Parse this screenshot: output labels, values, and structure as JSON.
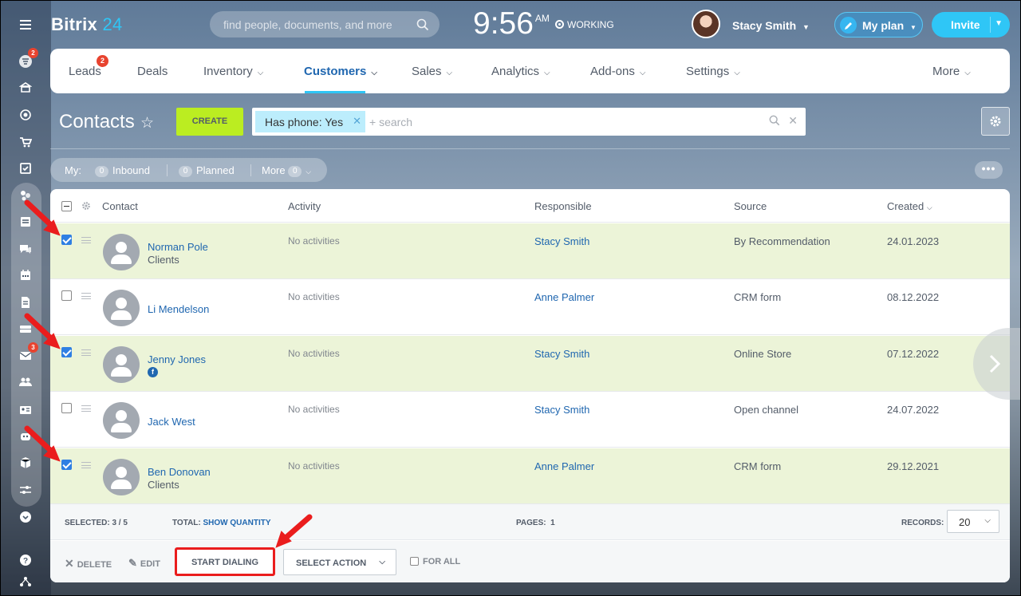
{
  "sidebar": {
    "badges": {
      "leads": "2",
      "mail": "3"
    }
  },
  "header": {
    "logo_main": "Bitrix",
    "logo_num": "24",
    "search_placeholder": "find people, documents, and more",
    "time": "9:56",
    "ampm": "AM",
    "status": "WORKING",
    "user_name": "Stacy Smith",
    "myplan_label": "My plan",
    "invite_label": "Invite"
  },
  "nav": {
    "items": [
      {
        "label": "Leads",
        "badge": "2"
      },
      {
        "label": "Deals"
      },
      {
        "label": "Inventory"
      },
      {
        "label": "Customers"
      },
      {
        "label": "Sales"
      },
      {
        "label": "Analytics"
      },
      {
        "label": "Add-ons"
      },
      {
        "label": "Settings"
      },
      {
        "label": "More"
      }
    ],
    "active": "Customers"
  },
  "page": {
    "title": "Contacts",
    "create_label": "CREATE",
    "filter_chip": "Has phone: Yes",
    "filter_placeholder": "+ search"
  },
  "counters": {
    "my": "My:",
    "inbound_count": "0",
    "inbound": "Inbound",
    "planned_count": "0",
    "planned": "Planned",
    "more": "More",
    "more_count": "0"
  },
  "grid": {
    "columns": [
      "Contact",
      "Activity",
      "Responsible",
      "Source",
      "Created"
    ],
    "rows": [
      {
        "name": "Norman Pole",
        "sub": "Clients",
        "activity": "No activities",
        "responsible": "Stacy Smith",
        "source": "By Recommendation",
        "created": "24.01.2023",
        "checked": true
      },
      {
        "name": "Li Mendelson",
        "sub": "",
        "activity": "No activities",
        "responsible": "Anne Palmer",
        "source": "CRM form",
        "created": "08.12.2022",
        "checked": false
      },
      {
        "name": "Jenny Jones",
        "sub": "",
        "activity": "No activities",
        "responsible": "Stacy Smith",
        "source": "Online Store",
        "created": "07.12.2022",
        "checked": true,
        "social": "f"
      },
      {
        "name": "Jack West",
        "sub": "",
        "activity": "No activities",
        "responsible": "Stacy Smith",
        "source": "Open channel",
        "created": "24.07.2022",
        "checked": false
      },
      {
        "name": "Ben Donovan",
        "sub": "Clients",
        "activity": "No activities",
        "responsible": "Anne Palmer",
        "source": "CRM form",
        "created": "29.12.2021",
        "checked": true
      }
    ]
  },
  "footer": {
    "selected_label": "SELECTED: 3 / 5",
    "total_label": "TOTAL:",
    "show_quantity": "SHOW QUANTITY",
    "pages_label": "PAGES:",
    "pages_value": "1",
    "records_label": "RECORDS:",
    "records_value": "20",
    "delete_label": "DELETE",
    "edit_label": "EDIT",
    "start_dialing_label": "START DIALING",
    "select_action_label": "SELECT ACTION",
    "for_all_label": "FOR ALL"
  },
  "colors": {
    "accent": "#2fc6f6",
    "create": "#bbed21",
    "link": "#2067b0",
    "selected_row": "#ecf4d8",
    "annotation": "#ea1d1d"
  }
}
